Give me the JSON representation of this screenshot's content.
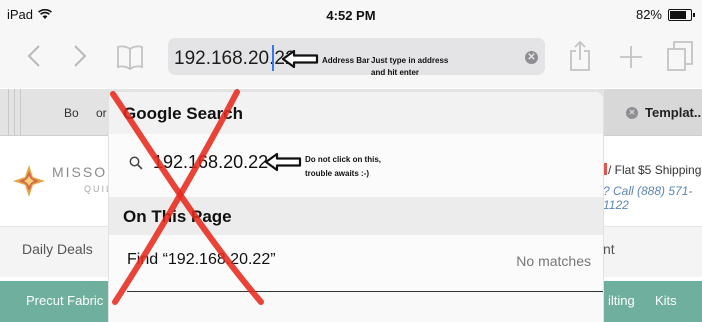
{
  "status_bar": {
    "device": "iPad",
    "time": "4:52 PM",
    "battery_percent": "82%"
  },
  "toolbar": {
    "address_value": "192.168.20.22"
  },
  "annotations": {
    "address_bar_label": "Address Bar",
    "address_hint_line1": "Just type in address",
    "address_hint_line2": "and hit enter",
    "suggestion_warning_line1": "Do not click on this,",
    "suggestion_warning_line2": "trouble awaits :-)"
  },
  "tabs": {
    "left_tab_partial": "Bo",
    "left_tab_partial2": "or",
    "right_tab": "Templat..."
  },
  "website": {
    "brand_partial": "MISSOU",
    "brand_sub_partial": "QUILT",
    "promo_partial": "/ Flat $5 Shipping",
    "phone_partial": "? Call (888) 571-1122",
    "nav_daily_deals": "Daily Deals",
    "nav_partial_right": "nt",
    "green_left": "Precut Fabric",
    "green_right1": "ilting",
    "green_right2": "Kits"
  },
  "suggestions": {
    "google_header": "Google Search",
    "google_query": "192.168.20.22",
    "page_header": "On This Page",
    "find_text": "Find “192.168.20.22”",
    "find_result": "No matches"
  },
  "colors": {
    "accent": "#3478f6",
    "site_green": "#6eaf9d",
    "cross_red": "#e8291c"
  }
}
